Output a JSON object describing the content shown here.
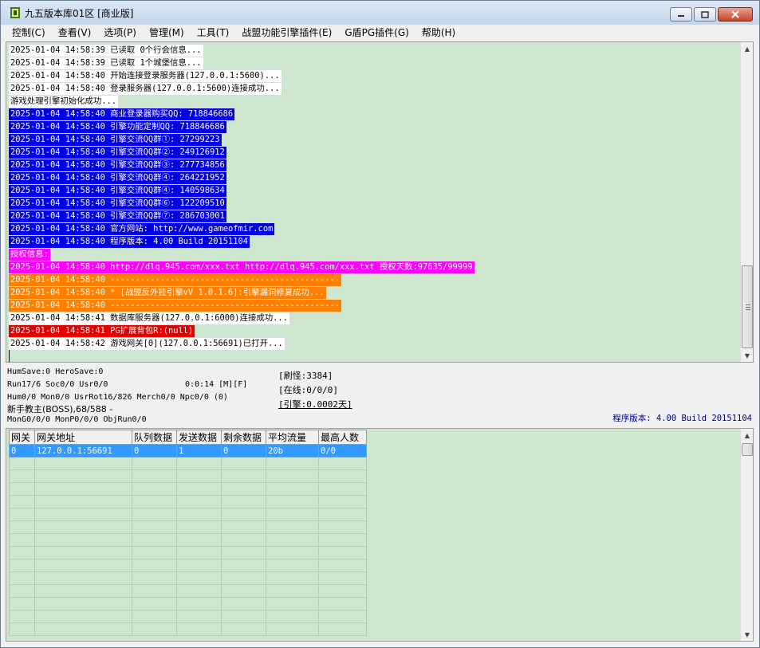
{
  "window": {
    "title": "九五版本库01区 [商业版]"
  },
  "menu": [
    "控制(C)",
    "查看(V)",
    "选项(P)",
    "管理(M)",
    "工具(T)",
    "战盟功能引擎插件(E)",
    "G盾PG插件(G)",
    "帮助(H)"
  ],
  "log": [
    {
      "text": "2025-01-04 14:58:39 已读取 0个行会信息...",
      "style": "white"
    },
    {
      "text": "2025-01-04 14:58:39 已读取 1个城堡信息...",
      "style": "white"
    },
    {
      "text": "2025-01-04 14:58:40 开始连接登录服务器(127.0.0.1:5600)...",
      "style": "white"
    },
    {
      "text": "2025-01-04 14:58:40 登录服务器(127.0.0.1:5600)连接成功...",
      "style": "white"
    },
    {
      "text": "游戏处理引擎初始化成功...",
      "style": "white"
    },
    {
      "text": "2025-01-04 14:58:40 商业登录器购买QQ: 718846686",
      "style": "blue"
    },
    {
      "text": "2025-01-04 14:58:40 引擎功能定制QQ: 718846686",
      "style": "blue"
    },
    {
      "text": "2025-01-04 14:58:40 引擎交流QQ群①: 27299223",
      "style": "blue"
    },
    {
      "text": "2025-01-04 14:58:40 引擎交流QQ群②: 249126912",
      "style": "blue"
    },
    {
      "text": "2025-01-04 14:58:40 引擎交流QQ群③: 277734856",
      "style": "blue"
    },
    {
      "text": "2025-01-04 14:58:40 引擎交流QQ群④: 264221952",
      "style": "blue"
    },
    {
      "text": "2025-01-04 14:58:40 引擎交流QQ群④: 140598634",
      "style": "blue"
    },
    {
      "text": "2025-01-04 14:58:40 引擎交流QQ群⑥: 122209510",
      "style": "blue"
    },
    {
      "text": "2025-01-04 14:58:40 引擎交流QQ群⑦: 286703001",
      "style": "blue"
    },
    {
      "text": "2025-01-04 14:58:40 官方网站: http://www.gameofmir.com",
      "style": "blue"
    },
    {
      "text": "2025-01-04 14:58:40 程序版本: 4.00 Build 20151104",
      "style": "blue"
    },
    {
      "text": "授权信息:",
      "style": "mag"
    },
    {
      "text": "2025-01-04 14:58:40 http://dlq.945.com/xxx.txt http://dlq.945.com/xxx.txt 授权天数:97635/99999",
      "style": "mag"
    },
    {
      "text": "2025-01-04 14:58:40 ----------------------------------------------",
      "style": "orange"
    },
    {
      "text": "2025-01-04 14:58:40 * [战盟反外挂引擎vV 1.0.1.6]:引擎漏洞修复成功...",
      "style": "orange"
    },
    {
      "text": "2025-01-04 14:58:40 ----------------------------------------------",
      "style": "orange"
    },
    {
      "text": "2025-01-04 14:58:41 数据库服务器(127.0.0.1:6000)连接成功...",
      "style": "white"
    },
    {
      "text": "2025-01-04 14:58:41 PG扩展背包R:(null)",
      "style": "red"
    },
    {
      "text": "2025-01-04 14:58:42 游戏网关[0](127.0.0.1:56691)已打开...",
      "style": "white"
    }
  ],
  "status": {
    "line1": "HumSave:0 HeroSave:0",
    "line2": "Run17/6 Soc0/0 Usr0/0",
    "time": "0:0:14 [M][F]",
    "line3": "Hum0/0 Mon0/0 UsrRot16/826 Merch0/0 Npc0/0 (0)",
    "line4": "新手教主(BOSS),68/588 -",
    "line5": "MonG0/0/0 MonP0/0/0 ObjRun0/0",
    "refresh": "[刷怪:3384]",
    "online": "[在线:0/0/0]",
    "engine": "[引擎:0.0002天]",
    "version": "程序版本: 4.00 Build 20151104"
  },
  "grid": {
    "headers": [
      "网关",
      "网关地址",
      "队列数据",
      "发送数据",
      "剩余数据",
      "平均流量",
      "最高人数"
    ],
    "rows": [
      [
        "0",
        "127.0.0.1:56691",
        "0",
        "1",
        "0",
        "20b",
        "0/0"
      ]
    ]
  },
  "colors": {
    "log_bg": "#cde6cd",
    "blue": "#0000e0",
    "magenta": "#ff00ff",
    "orange": "#ff8000",
    "red": "#e00000",
    "selection": "#3399ff"
  }
}
